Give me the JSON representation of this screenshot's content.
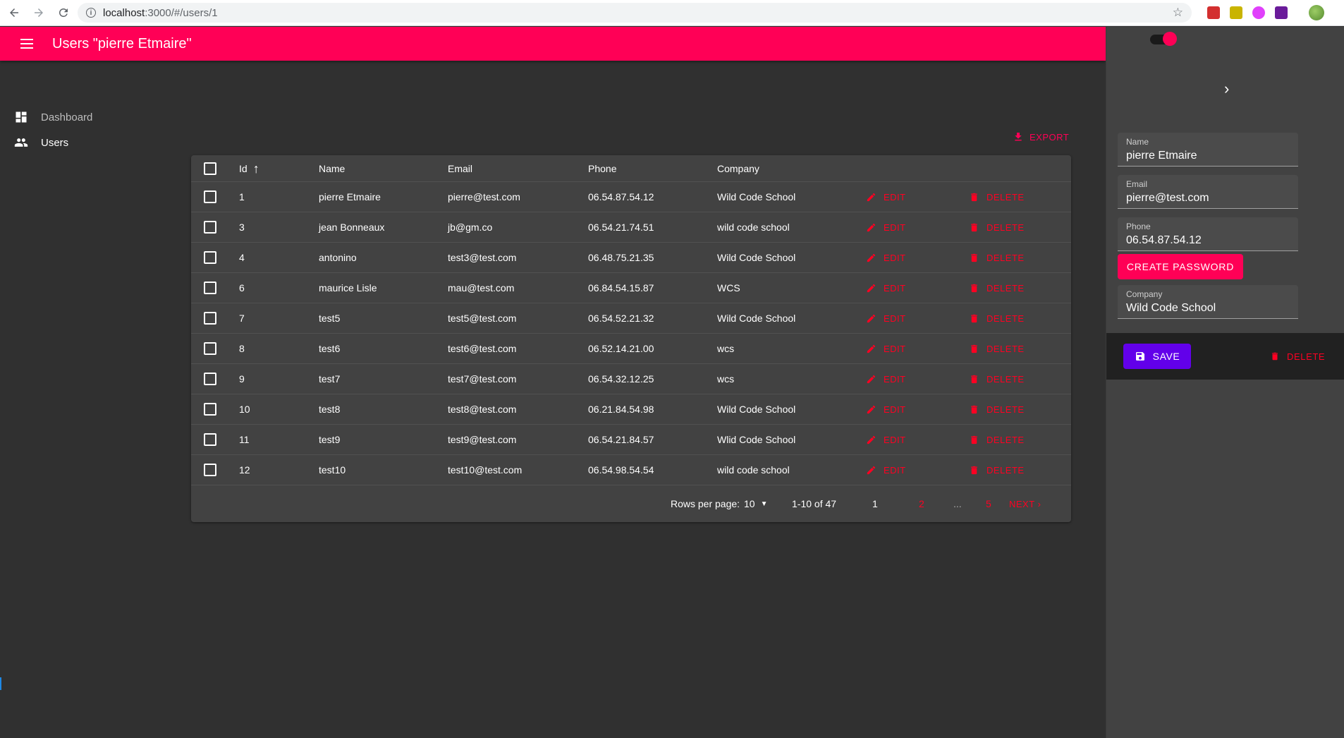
{
  "browser": {
    "url_host": "localhost",
    "url_path": ":3000/#/users/1"
  },
  "appbar": {
    "title": "Users \"pierre Etmaire\""
  },
  "sidebar": {
    "items": [
      {
        "label": "Dashboard",
        "icon": "dashboard-icon"
      },
      {
        "label": "Users",
        "icon": "users-icon"
      }
    ]
  },
  "toolbar": {
    "export_label": "EXPORT"
  },
  "table": {
    "headers": {
      "id": "Id",
      "name": "Name",
      "email": "Email",
      "phone": "Phone",
      "company": "Company"
    },
    "edit_label": "EDIT",
    "delete_label": "DELETE",
    "rows": [
      {
        "id": "1",
        "name": "pierre Etmaire",
        "email": "pierre@test.com",
        "phone": "06.54.87.54.12",
        "company": "Wild Code School"
      },
      {
        "id": "3",
        "name": "jean Bonneaux",
        "email": "jb@gm.co",
        "phone": "06.54.21.74.51",
        "company": "wild code school"
      },
      {
        "id": "4",
        "name": "antonino",
        "email": "test3@test.com",
        "phone": "06.48.75.21.35",
        "company": "Wild Code School"
      },
      {
        "id": "6",
        "name": "maurice Lisle",
        "email": "mau@test.com",
        "phone": "06.84.54.15.87",
        "company": "WCS"
      },
      {
        "id": "7",
        "name": "test5",
        "email": "test5@test.com",
        "phone": "06.54.52.21.32",
        "company": "Wild Code School"
      },
      {
        "id": "8",
        "name": "test6",
        "email": "test6@test.com",
        "phone": "06.52.14.21.00",
        "company": "wcs"
      },
      {
        "id": "9",
        "name": "test7",
        "email": "test7@test.com",
        "phone": "06.54.32.12.25",
        "company": "wcs"
      },
      {
        "id": "10",
        "name": "test8",
        "email": "test8@test.com",
        "phone": "06.21.84.54.98",
        "company": "Wild Code School"
      },
      {
        "id": "11",
        "name": "test9",
        "email": "test9@test.com",
        "phone": "06.54.21.84.57",
        "company": "Wlid Code School"
      },
      {
        "id": "12",
        "name": "test10",
        "email": "test10@test.com",
        "phone": "06.54.98.54.54",
        "company": "wild code school"
      }
    ]
  },
  "pager": {
    "rows_per_page_label": "Rows per page:",
    "rows_per_page_value": "10",
    "range": "1-10 of 47",
    "page_1": "1",
    "page_2": "2",
    "ellipsis": "...",
    "page_last": "5",
    "next_label": "NEXT"
  },
  "edit_panel": {
    "fields": {
      "name": {
        "label": "Name",
        "value": "pierre Etmaire"
      },
      "email": {
        "label": "Email",
        "value": "pierre@test.com"
      },
      "phone": {
        "label": "Phone",
        "value": "06.54.87.54.12"
      },
      "company": {
        "label": "Company",
        "value": "Wild Code School"
      }
    },
    "create_password_label": "CREATE PASSWORD",
    "save_label": "SAVE",
    "delete_label": "DELETE"
  },
  "colors": {
    "accent": "#ff0056",
    "danger": "#ff0022",
    "save": "#6200ea",
    "background": "#303030",
    "surface": "#424242"
  }
}
